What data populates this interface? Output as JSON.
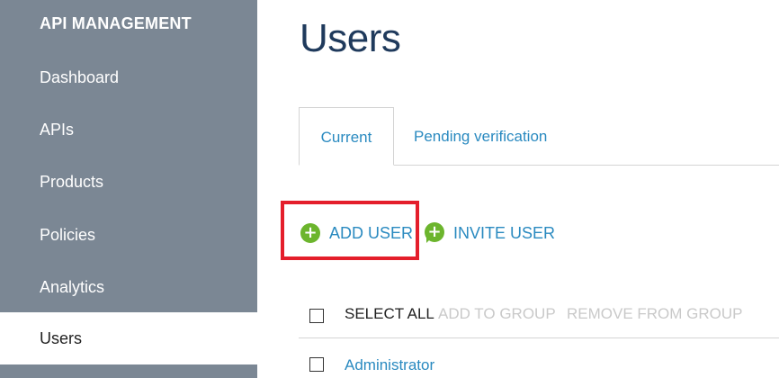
{
  "sidebar": {
    "header": "API MANAGEMENT",
    "items": [
      {
        "label": "Dashboard"
      },
      {
        "label": "APIs"
      },
      {
        "label": "Products"
      },
      {
        "label": "Policies"
      },
      {
        "label": "Analytics"
      },
      {
        "label": "Users",
        "active": true
      }
    ]
  },
  "main": {
    "title": "Users",
    "tabs": [
      {
        "label": "Current",
        "selected": true
      },
      {
        "label": "Pending verification"
      }
    ],
    "actions": {
      "add_user": "ADD USER",
      "invite_user": "INVITE USER",
      "add_icon": "plus-circle-icon",
      "invite_icon": "plus-speech-bubble-icon"
    },
    "bulk": {
      "select_all": "SELECT ALL",
      "add_to_group": "ADD TO GROUP",
      "remove_from_group": "REMOVE FROM GROUP"
    },
    "users": [
      {
        "name": "Administrator"
      }
    ]
  },
  "colors": {
    "sidebar_bg": "#7b8794",
    "link": "#2a8ac0",
    "title": "#1f3a5c",
    "icon_green": "#6cb52d",
    "highlight": "#e41e2b",
    "disabled": "#c9c9c9"
  }
}
